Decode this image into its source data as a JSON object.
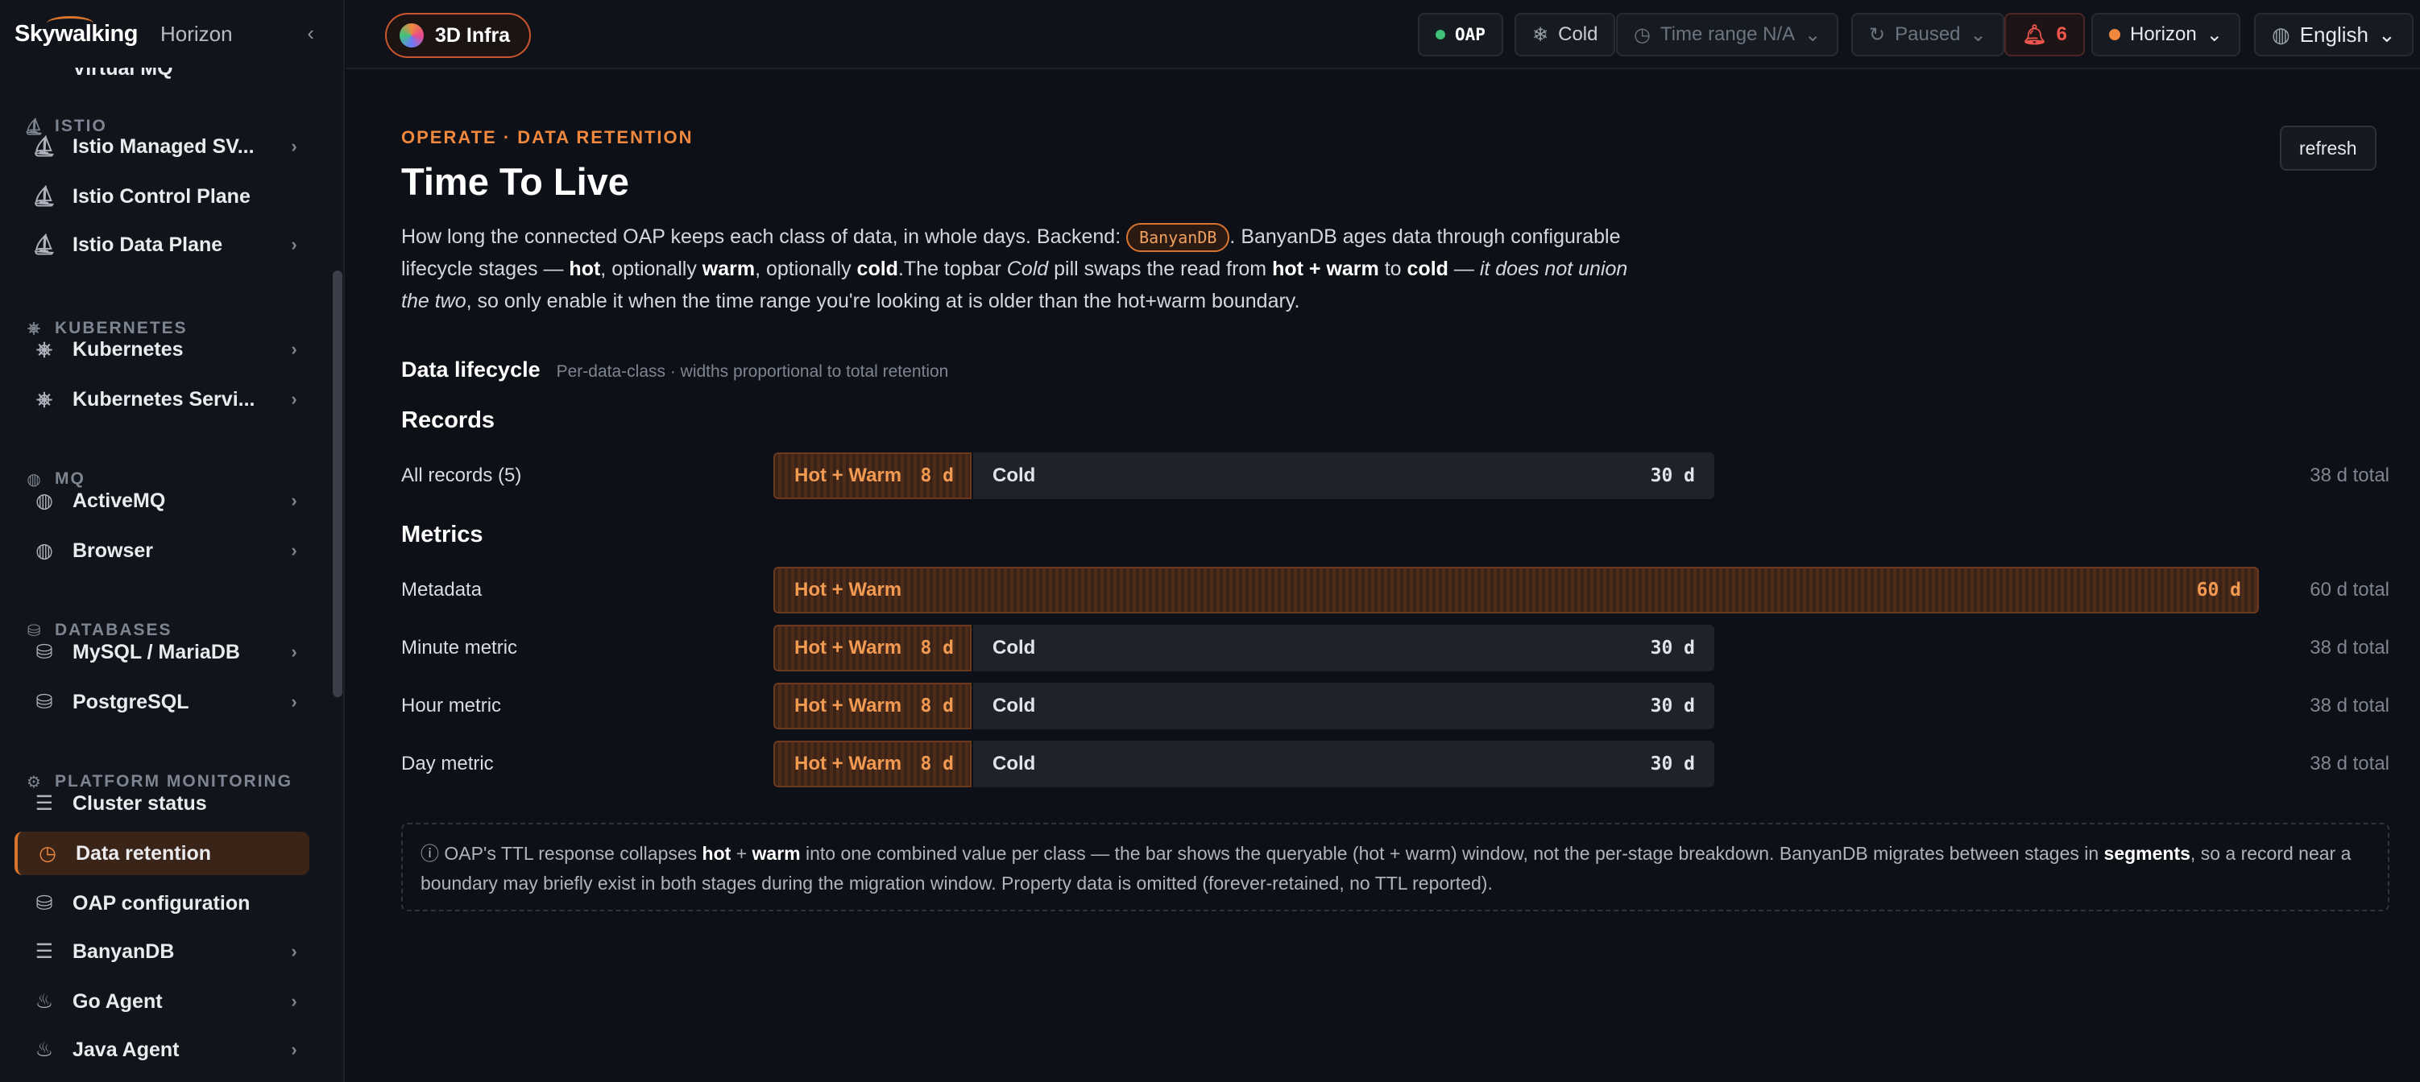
{
  "sidebar": {
    "logo": "Skywalking",
    "brand": "Horizon",
    "collapse_icon": "chevron-left",
    "cut_item": "Virtual MQ",
    "sections": [
      {
        "label": "ISTIO",
        "icon": "sail-icon"
      },
      {
        "label": "KUBERNETES",
        "icon": "helm-icon"
      },
      {
        "label": "MQ",
        "icon": "globe-icon"
      },
      {
        "label": "DATABASES",
        "icon": "database-icon"
      },
      {
        "label": "PLATFORM MONITORING",
        "icon": "gear-icon"
      }
    ],
    "items": [
      {
        "label": "Istio Managed SV...",
        "icon": "sail-icon",
        "chevron": true
      },
      {
        "label": "Istio Control Plane",
        "icon": "sail-icon",
        "chevron": false
      },
      {
        "label": "Istio Data Plane",
        "icon": "sail-icon",
        "chevron": true
      },
      {
        "label": "Kubernetes",
        "icon": "helm-icon",
        "chevron": true
      },
      {
        "label": "Kubernetes Servi...",
        "icon": "helm-icon",
        "chevron": true
      },
      {
        "label": "ActiveMQ",
        "icon": "globe-icon",
        "chevron": true
      },
      {
        "label": "Browser",
        "icon": "globe-icon",
        "chevron": true
      },
      {
        "label": "MySQL / MariaDB",
        "icon": "database-icon",
        "chevron": true
      },
      {
        "label": "PostgreSQL",
        "icon": "database-icon",
        "chevron": true
      },
      {
        "label": "Cluster status",
        "icon": "server-icon",
        "chevron": false
      },
      {
        "label": "Data retention",
        "icon": "clock-icon",
        "chevron": false,
        "active": true
      },
      {
        "label": "OAP configuration",
        "icon": "database-icon",
        "chevron": false
      },
      {
        "label": "BanyanDB",
        "icon": "server-icon",
        "chevron": true
      },
      {
        "label": "Go Agent",
        "icon": "flame-icon",
        "chevron": true
      },
      {
        "label": "Java Agent",
        "icon": "flame-icon",
        "chevron": true
      }
    ]
  },
  "topbar": {
    "infra_label": "3D Infra",
    "oap_label": "OAP",
    "oap_status_color": "#3fc27a",
    "cold_label": "Cold",
    "time_range_label": "Time range N/A",
    "paused_label": "Paused",
    "alarm_count": "6",
    "layer_label": "Horizon",
    "layer_color": "#f0883e",
    "language_label": "English"
  },
  "page": {
    "eyebrow": "OPERATE · DATA RETENTION",
    "title": "Time To Live",
    "refresh_label": "refresh",
    "desc": {
      "p1": "How long the connected OAP keeps each class of data, in whole days. Backend: ",
      "backend": "BanyanDB",
      "p2": ". BanyanDB ages data through configurable lifecycle stages — ",
      "hot": "hot",
      "p3": ", optionally ",
      "warm": "warm",
      "p4": ", optionally ",
      "cold": "cold",
      "p5": ".The topbar ",
      "cold_pill": "Cold",
      "p6": " pill swaps the read from ",
      "hotwarm": "hot + warm",
      "p7": " to ",
      "cold2": "cold",
      "p8": " — ",
      "union": "it does not union the two",
      "p9": ", so only enable it when the time range you're looking at is older than the hot+warm boundary."
    },
    "lifecycle_title": "Data lifecycle",
    "lifecycle_subtitle": "Per-data-class · widths proportional to total retention",
    "note": {
      "p1": "ⓘ OAP's TTL response collapses ",
      "hot": "hot",
      "plus": " + ",
      "warm": "warm",
      "p2": " into one combined value per class — the bar shows the queryable (hot + warm) window, not the per-stage breakdown. BanyanDB migrates between stages in ",
      "segments": "segments",
      "p3": ", so a record near a boundary may briefly exist in both stages during the migration window. Property data is omitted (forever-retained, no TTL reported)."
    }
  },
  "chart_data": {
    "type": "bar",
    "stacked": true,
    "groups": [
      {
        "title": "Records",
        "rows": [
          {
            "label": "All records (5)",
            "hot_label": "Hot + Warm",
            "hot": 8,
            "hot_text": "8 d",
            "cold_label": "Cold",
            "cold": 30,
            "cold_text": "30 d",
            "total_text": "38 d total"
          }
        ]
      },
      {
        "title": "Metrics",
        "rows": [
          {
            "label": "Metadata",
            "hot_label": "Hot + Warm",
            "hot": 60,
            "hot_text": "60 d",
            "cold_label": "",
            "cold": 0,
            "cold_text": "",
            "total_text": "60 d total"
          },
          {
            "label": "Minute metric",
            "hot_label": "Hot + Warm",
            "hot": 8,
            "hot_text": "8 d",
            "cold_label": "Cold",
            "cold": 30,
            "cold_text": "30 d",
            "total_text": "38 d total"
          },
          {
            "label": "Hour metric",
            "hot_label": "Hot + Warm",
            "hot": 8,
            "hot_text": "8 d",
            "cold_label": "Cold",
            "cold": 30,
            "cold_text": "30 d",
            "total_text": "38 d total"
          },
          {
            "label": "Day metric",
            "hot_label": "Hot + Warm",
            "hot": 8,
            "hot_text": "8 d",
            "cold_label": "Cold",
            "cold": 30,
            "cold_text": "30 d",
            "total_text": "38 d total"
          }
        ]
      }
    ],
    "max_total": 60,
    "colors": {
      "hot": "#f39a52",
      "cold": "#1d222b"
    }
  }
}
